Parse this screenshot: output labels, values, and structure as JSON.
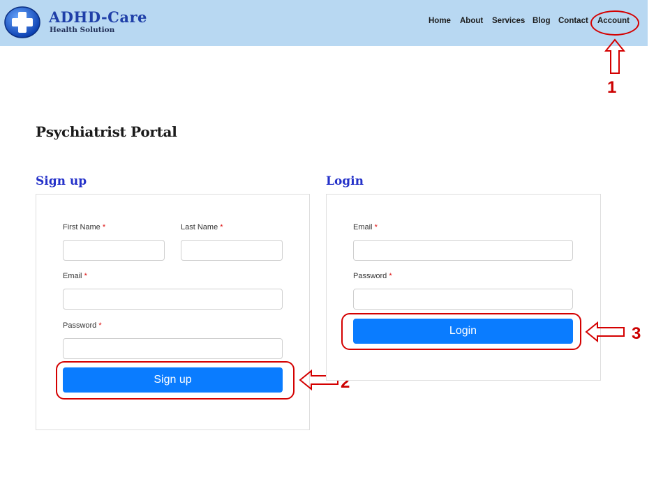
{
  "header": {
    "brand_name": "ADHD-Care",
    "tagline": "Health Solution",
    "nav": [
      {
        "label": "Home"
      },
      {
        "label": "About"
      },
      {
        "label": "Services"
      },
      {
        "label": "Blog"
      },
      {
        "label": "Contact"
      },
      {
        "label": "Account"
      }
    ],
    "colors": {
      "header_bg": "#b8d8f2",
      "brand": "#1f3fa8"
    }
  },
  "page": {
    "title": "Psychiatrist Portal"
  },
  "signup": {
    "title": "Sign up",
    "first_name_label": "First Name",
    "last_name_label": "Last Name",
    "email_label": "Email",
    "password_label": "Password",
    "required_mark": "*",
    "first_name_value": "",
    "last_name_value": "",
    "email_value": "",
    "password_value": "",
    "button_label": "Sign up"
  },
  "login": {
    "title": "Login",
    "email_label": "Email",
    "password_label": "Password",
    "required_mark": "*",
    "email_value": "",
    "password_value": "",
    "button_label": "Login"
  },
  "annotations": {
    "step1": "1",
    "step2": "2",
    "step3": "3",
    "color": "#d40000"
  },
  "colors": {
    "accent_button": "#0a7cff",
    "section_title": "#2431c9"
  }
}
